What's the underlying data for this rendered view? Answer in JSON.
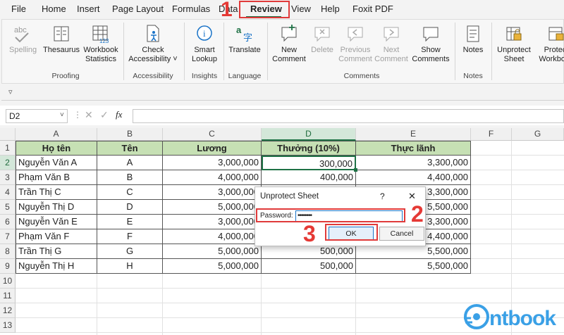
{
  "menu": {
    "items": [
      "File",
      "Home",
      "Insert",
      "Page Layout",
      "Formulas",
      "Data",
      "Review",
      "View",
      "Help",
      "Foxit PDF"
    ],
    "active": "Review"
  },
  "ribbon": {
    "proofing": {
      "label": "Proofing",
      "buttons": [
        {
          "label": "Spelling",
          "disabled": true
        },
        {
          "label": "Thesaurus"
        },
        {
          "label": "Workbook Statistics"
        }
      ]
    },
    "accessibility": {
      "label": "Accessibility",
      "buttons": [
        {
          "label": "Check Accessibility ˅"
        }
      ]
    },
    "insights": {
      "label": "Insights",
      "buttons": [
        {
          "label": "Smart Lookup"
        }
      ]
    },
    "language": {
      "label": "Language",
      "buttons": [
        {
          "label": "Translate"
        }
      ]
    },
    "comments": {
      "label": "Comments",
      "buttons": [
        {
          "label": "New Comment"
        },
        {
          "label": "Delete",
          "disabled": true
        },
        {
          "label": "Previous Comment",
          "disabled": true
        },
        {
          "label": "Next Comment",
          "disabled": true
        },
        {
          "label": "Show Comments"
        }
      ]
    },
    "notes": {
      "label": "Notes",
      "buttons": [
        {
          "label": "Notes"
        }
      ]
    },
    "protect": {
      "buttons": [
        {
          "label": "Unprotect Sheet"
        },
        {
          "label": "Protect Workbook"
        }
      ]
    }
  },
  "formula_bar": {
    "name_box": "D2",
    "fx": "fx",
    "value": ""
  },
  "sheet": {
    "columns": [
      "A",
      "B",
      "C",
      "D",
      "E",
      "F",
      "G"
    ],
    "selected_column": "D",
    "rows": [
      "1",
      "2",
      "3",
      "4",
      "5",
      "6",
      "7",
      "8",
      "9",
      "10",
      "11",
      "12",
      "13"
    ],
    "selected_row": "2",
    "headers": [
      "Họ tên",
      "Tên",
      "Lương",
      "Thưởng (10%)",
      "Thực lãnh"
    ],
    "data": [
      [
        "Nguyễn Văn A",
        "A",
        "3,000,000",
        "300,000",
        "3,300,000"
      ],
      [
        "Phạm Văn B",
        "B",
        "4,000,000",
        "400,000",
        "4,400,000"
      ],
      [
        "Trần Thị C",
        "C",
        "3,000,000",
        "",
        "3,300,000"
      ],
      [
        "Nguyễn Thị D",
        "D",
        "5,000,000",
        "",
        "5,500,000"
      ],
      [
        "Nguyễn Văn E",
        "E",
        "3,000,000",
        "",
        "3,300,000"
      ],
      [
        "Phạm Văn F",
        "F",
        "4,000,000",
        "",
        "4,400,000"
      ],
      [
        "Trần Thị G",
        "G",
        "5,000,000",
        "500,000",
        "5,500,000"
      ],
      [
        "Nguyễn Thị H",
        "H",
        "5,000,000",
        "500,000",
        "5,500,000"
      ]
    ]
  },
  "dialog": {
    "title": "Unprotect Sheet",
    "help": "?",
    "close": "✕",
    "password_label": "Password:",
    "password_value": "••••••••",
    "ok": "OK",
    "cancel": "Cancel"
  },
  "annotations": {
    "step1": "1",
    "step2": "2",
    "step3": "3"
  },
  "watermark": {
    "text": "ntbook"
  },
  "colors": {
    "header_fill": "#c6e0b4",
    "accent": "#1e7145",
    "annotation_red": "#e53935",
    "logo_blue": "#3aa0e6"
  }
}
